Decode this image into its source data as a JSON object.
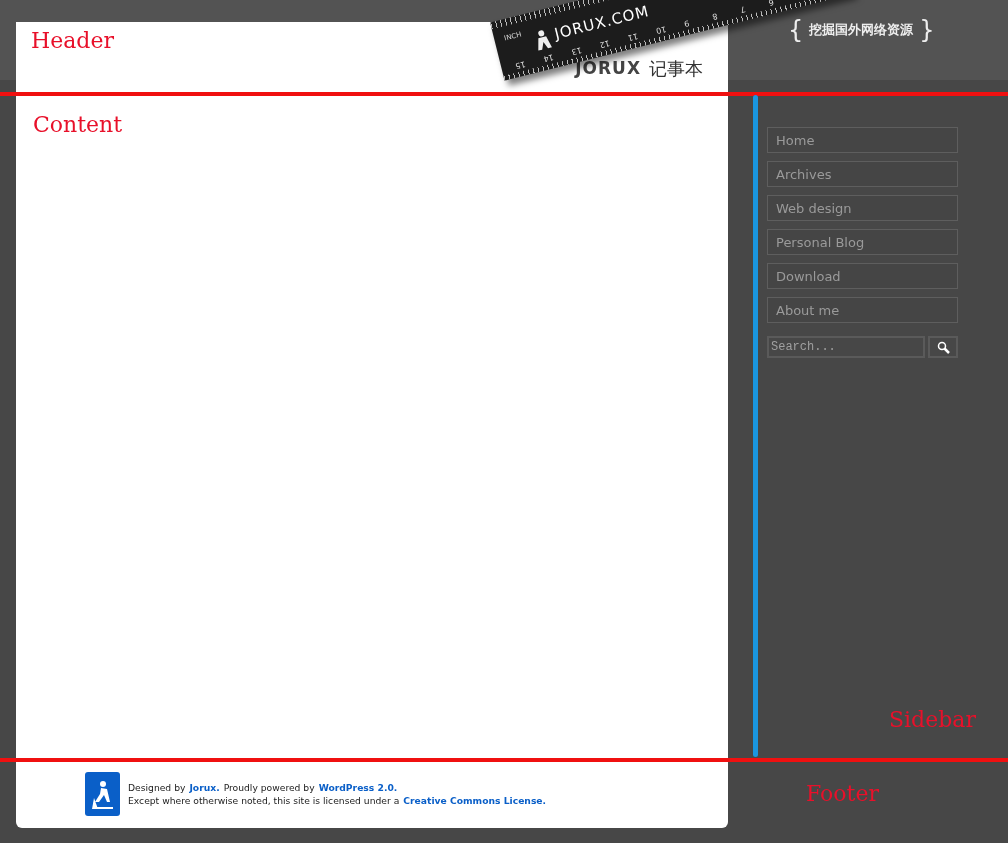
{
  "header": {
    "ruler": {
      "brand": "JORUX.COM",
      "unit": "INCH",
      "numbers": [
        "15",
        "14",
        "13",
        "12",
        "11",
        "10",
        "9",
        "8",
        "7",
        "6"
      ]
    },
    "logo": {
      "mark": "JORUX",
      "name": "记事本"
    },
    "slogan": {
      "open": "{",
      "text": "挖掘国外网络资源",
      "close": "}"
    }
  },
  "sidebar": {
    "menu": [
      {
        "label": "Home"
      },
      {
        "label": "Archives"
      },
      {
        "label": "Web design"
      },
      {
        "label": "Personal Blog"
      },
      {
        "label": "Download"
      },
      {
        "label": "About me"
      }
    ],
    "search": {
      "placeholder": "Search..."
    }
  },
  "footer": {
    "lines": [
      [
        {
          "kind": "text",
          "text": "Designed by"
        },
        {
          "kind": "link",
          "text": "Jorux."
        },
        {
          "kind": "text",
          "text": "Proudly powered by"
        },
        {
          "kind": "link",
          "text": "WordPress 2.0."
        }
      ],
      [
        {
          "kind": "text",
          "text": "Except where otherwise noted, this site is licensed under a"
        },
        {
          "kind": "link",
          "text": "Creative Commons License."
        }
      ]
    ]
  },
  "annotations": [
    {
      "label": "Header"
    },
    {
      "label": "Content"
    },
    {
      "label": "Sidebar"
    },
    {
      "label": "Footer"
    }
  ]
}
